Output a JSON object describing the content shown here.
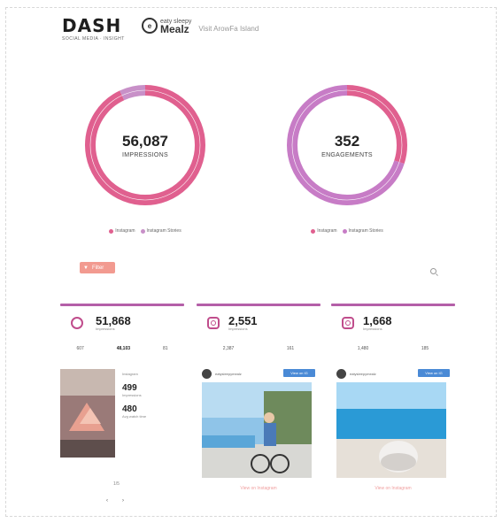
{
  "header": {
    "logo_main": "DASH",
    "logo_sub": "SOCIAL MEDIA · INSIGHT",
    "brand_small": "eaty sleepy",
    "brand_name": "Mealz",
    "brand_badge": "e",
    "brand_caption": "Visit ArowFa Island"
  },
  "donuts": [
    {
      "value": "56,087",
      "label": "IMPRESSIONS",
      "segments": [
        {
          "name": "Instagram",
          "fraction": 0.93,
          "color": "#e0608f"
        },
        {
          "name": "Instagram Stories",
          "fraction": 0.07,
          "color": "#c890c8"
        }
      ],
      "legend": [
        "Instagram",
        "Instagram Stories"
      ]
    },
    {
      "value": "352",
      "label": "ENGAGEMENTS",
      "segments": [
        {
          "name": "Instagram",
          "fraction": 0.3,
          "color": "#e0608f"
        },
        {
          "name": "Instagram Stories",
          "fraction": 0.7,
          "color": "#c77cc6"
        }
      ],
      "legend": [
        "Instagram",
        "Instagram Stories"
      ]
    }
  ],
  "filter": {
    "label": "Filter",
    "icon": "filter-icon"
  },
  "cards": [
    {
      "stat": "51,868",
      "stat_label": "Impressions",
      "metrics": [
        "607",
        "48,103",
        "81"
      ],
      "post_user": "Instagram",
      "side_values": [
        "499",
        "480"
      ],
      "side_labels": [
        "Impressions",
        "Avg watch time"
      ],
      "pager_count": "1/5",
      "pager_prev": "‹",
      "pager_next": "›"
    },
    {
      "stat": "2,551",
      "stat_label": "Impressions",
      "metrics": [
        "2,387",
        "161"
      ],
      "post_user": "eatysleepymealz",
      "follow": "View on IG",
      "view_link": "View on Instagram"
    },
    {
      "stat": "1,668",
      "stat_label": "Impressions",
      "metrics": [
        "1,480",
        "185"
      ],
      "post_user": "eatysleepymealz",
      "follow": "View on IG",
      "view_link": "View on Instagram"
    }
  ]
}
